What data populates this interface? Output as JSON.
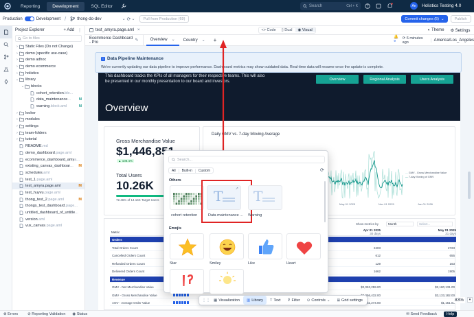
{
  "topbar": {
    "tabs": [
      "Reporting",
      "Development",
      "SQL Editor"
    ],
    "search_placeholder": "Search",
    "search_shortcut": "Ctrl + K",
    "avatar": "An",
    "workspace": "Holistics Testing 4.0"
  },
  "toolbar2": {
    "production": "Production",
    "development": "Development",
    "branch": "thong-do-dev",
    "pull": "Pull from Production (69)",
    "commit": "Commit changes (5)",
    "publish": "Publish"
  },
  "explorer": {
    "title": "Project Explorer",
    "add": "Add",
    "search_placeholder": "Go to files",
    "items": [
      {
        "name": "Static Files (Do not Change)",
        "ext": "",
        "badge": "",
        "depth": 0,
        "type": "folder",
        "chev": "›"
      },
      {
        "name": "demo (specific use-case)",
        "ext": "",
        "badge": "",
        "depth": 0,
        "type": "folder",
        "chev": "›"
      },
      {
        "name": "demo adhoc",
        "ext": "",
        "badge": "",
        "depth": 0,
        "type": "folder",
        "chev": "›"
      },
      {
        "name": "demo ecommerce",
        "ext": "",
        "badge": "",
        "depth": 0,
        "type": "folder",
        "chev": "›"
      },
      {
        "name": "holistics",
        "ext": "",
        "badge": "",
        "depth": 0,
        "type": "folder",
        "chev": "›"
      },
      {
        "name": "library",
        "ext": "",
        "badge": "",
        "depth": 0,
        "type": "folder",
        "chev": "⌄"
      },
      {
        "name": "blocks",
        "ext": "",
        "badge": "",
        "depth": 1,
        "type": "folder",
        "chev": "⌄"
      },
      {
        "name": "cohort_retention",
        "ext": ".blo...",
        "badge": "",
        "depth": 2,
        "type": "file",
        "chev": ""
      },
      {
        "name": "data_maintenance",
        "ext": "...",
        "badge": "N",
        "depth": 2,
        "type": "file",
        "chev": ""
      },
      {
        "name": "warning",
        "ext": ".block.aml",
        "badge": "N",
        "depth": 2,
        "type": "file",
        "chev": ""
      },
      {
        "name": "looker",
        "ext": "",
        "badge": "",
        "depth": 0,
        "type": "folder",
        "chev": "›"
      },
      {
        "name": "modules",
        "ext": "",
        "badge": "",
        "depth": 0,
        "type": "folder",
        "chev": "›"
      },
      {
        "name": "settings",
        "ext": "",
        "badge": "",
        "depth": 0,
        "type": "folder",
        "chev": "›"
      },
      {
        "name": "team-folders",
        "ext": "",
        "badge": "",
        "depth": 0,
        "type": "folder",
        "chev": "›"
      },
      {
        "name": "tutorial",
        "ext": "",
        "badge": "",
        "depth": 0,
        "type": "folder",
        "chev": "›"
      },
      {
        "name": "README",
        "ext": ".md",
        "badge": "",
        "depth": 0,
        "type": "file",
        "chev": ""
      },
      {
        "name": "demo_dashboard",
        "ext": ".page.aml",
        "badge": "",
        "depth": 0,
        "type": "file",
        "chev": ""
      },
      {
        "name": "ecommerce_dashboard_amy",
        "ext": "a...",
        "badge": "",
        "depth": 0,
        "type": "file",
        "chev": ""
      },
      {
        "name": "existing_canvas_dashboar",
        "ext": "...",
        "badge": "M",
        "depth": 0,
        "type": "file",
        "chev": ""
      },
      {
        "name": "schedules",
        "ext": ".aml",
        "badge": "",
        "depth": 0,
        "type": "file",
        "chev": ""
      },
      {
        "name": "test_1",
        "ext": ".page.aml",
        "badge": "",
        "depth": 0,
        "type": "file",
        "chev": ""
      },
      {
        "name": "test_amyra.page.aml",
        "ext": "",
        "badge": "M",
        "depth": 0,
        "type": "file",
        "chev": "",
        "sel": true
      },
      {
        "name": "test_huyvu",
        "ext": ".page.aml",
        "badge": "",
        "depth": 0,
        "type": "file",
        "chev": ""
      },
      {
        "name": "thong_test_2",
        "ext": ".page.aml",
        "badge": "M",
        "depth": 0,
        "type": "file",
        "chev": ""
      },
      {
        "name": "thongs_test_dashboard",
        "ext": ".page...",
        "badge": "",
        "depth": 0,
        "type": "file",
        "chev": ""
      },
      {
        "name": "untitled_dashboard_of_untitle",
        "ext": "...",
        "badge": "",
        "depth": 0,
        "type": "file",
        "chev": ""
      },
      {
        "name": "version",
        "ext": ".aml",
        "badge": "",
        "depth": 0,
        "type": "file",
        "chev": ""
      },
      {
        "name": "vux_canvas",
        "ext": ".page.aml",
        "badge": "",
        "depth": 0,
        "type": "file",
        "chev": ""
      }
    ]
  },
  "editor": {
    "file_tab": "test_amyra.page.aml",
    "modes": [
      "Code",
      "Dual",
      "Visual"
    ],
    "theme": "Theme",
    "settings": "Settings"
  },
  "tabs": {
    "dashboard_title": "Ecommerce Dashboard - Pro",
    "items": [
      "Overview",
      "Country"
    ],
    "notif_count": "9",
    "last_update": "6 minutes ago",
    "timezone": "America/Los_Angeles"
  },
  "banner": {
    "title": "Data Pipeline Maintenance",
    "text": "We're currently updating our data pipeline to improve performance. Dashboard metrics may show outdated data. Real-time data will resume once the update is complete."
  },
  "hero": {
    "text": "This dashboard tracks the KPIs of all managers for their respective teams. This will also be presented in our monthly presentation to our board and investors.",
    "nav": [
      "Overview",
      "Regional Analysis",
      "Users Analysis"
    ],
    "title": "Overview"
  },
  "kpi": {
    "gmv_label": "Gross Merchandise Value",
    "gmv_value": "$1,446,851",
    "gmv_badge": "▲ 108.4%",
    "users_label": "Total Users",
    "users_value": "10.26K",
    "users_bar_fraction": 0.72,
    "users_caption": "72.46% of 14.16K Target Users"
  },
  "chart": {
    "title": "Daily GMV vs. 7-day Moving Average",
    "legend": [
      "GMV - Gross Merchandise Value",
      "7-day Moving of GMV"
    ],
    "x_ticks": [
      "May 01 2025",
      "Nov 01 2025",
      "Jan 01 2026"
    ],
    "colors": {
      "gmv": "#99d8cf",
      "ma": "#0d9488"
    }
  },
  "table": {
    "show_metrics_by": "Show metrics by",
    "period": "Month",
    "filter": "Select...",
    "metric_header": "Metric",
    "col1_header": "Apr 01 2025",
    "col1_sub": "30 days",
    "col2_header": "May 01 2025",
    "col2_sub": "31 days",
    "rows": [
      {
        "label": "Orders",
        "v1": "",
        "v2": "",
        "section": true
      },
      {
        "label": "Total Orders Count",
        "v1": "2403",
        "v2": "2723",
        "section": false
      },
      {
        "label": "Cancelled Orders Count",
        "v1": "612",
        "v2": "655",
        "section": false
      },
      {
        "label": "Refunded Orders Count",
        "v1": "129",
        "v2": "163",
        "section": false
      },
      {
        "label": "Delivered Orders Count",
        "v1": "1662",
        "v2": "1905",
        "section": false
      },
      {
        "label": "Revenue",
        "v1": "",
        "v2": "",
        "section": true
      },
      {
        "label": "GMV - Net Merchandise Value",
        "v1": "$2,053,259.00",
        "v2": "$2,180,131.00",
        "section": false
      },
      {
        "label": "GMV - Gross Merchandise Value",
        "v1": "$3,056,432.00",
        "v2": "$3,133,182.00",
        "section": false
      },
      {
        "label": "AOV - Average Order Value",
        "v1": "$1,274.00",
        "v2": "$1,151.00",
        "section": false
      }
    ]
  },
  "popup": {
    "search_placeholder": "Search...",
    "filters": [
      "All",
      "Built-in",
      "Custom"
    ],
    "others_title": "Others",
    "others": [
      "cohort retention",
      "Data maintenance ...",
      "Warning"
    ],
    "emojis_title": "Emojis",
    "emojis": [
      "Star",
      "Smiley",
      "Like",
      "Heart"
    ]
  },
  "bottombar": {
    "items": [
      "Visualization",
      "Library",
      "Text",
      "Filter",
      "Controls",
      "Grid settings"
    ]
  },
  "zoom": "83%",
  "statusbar": {
    "errors": "Errors",
    "validation": "Reporting Validation",
    "status": "Status",
    "feedback": "Send Feedback",
    "help": "Help"
  }
}
